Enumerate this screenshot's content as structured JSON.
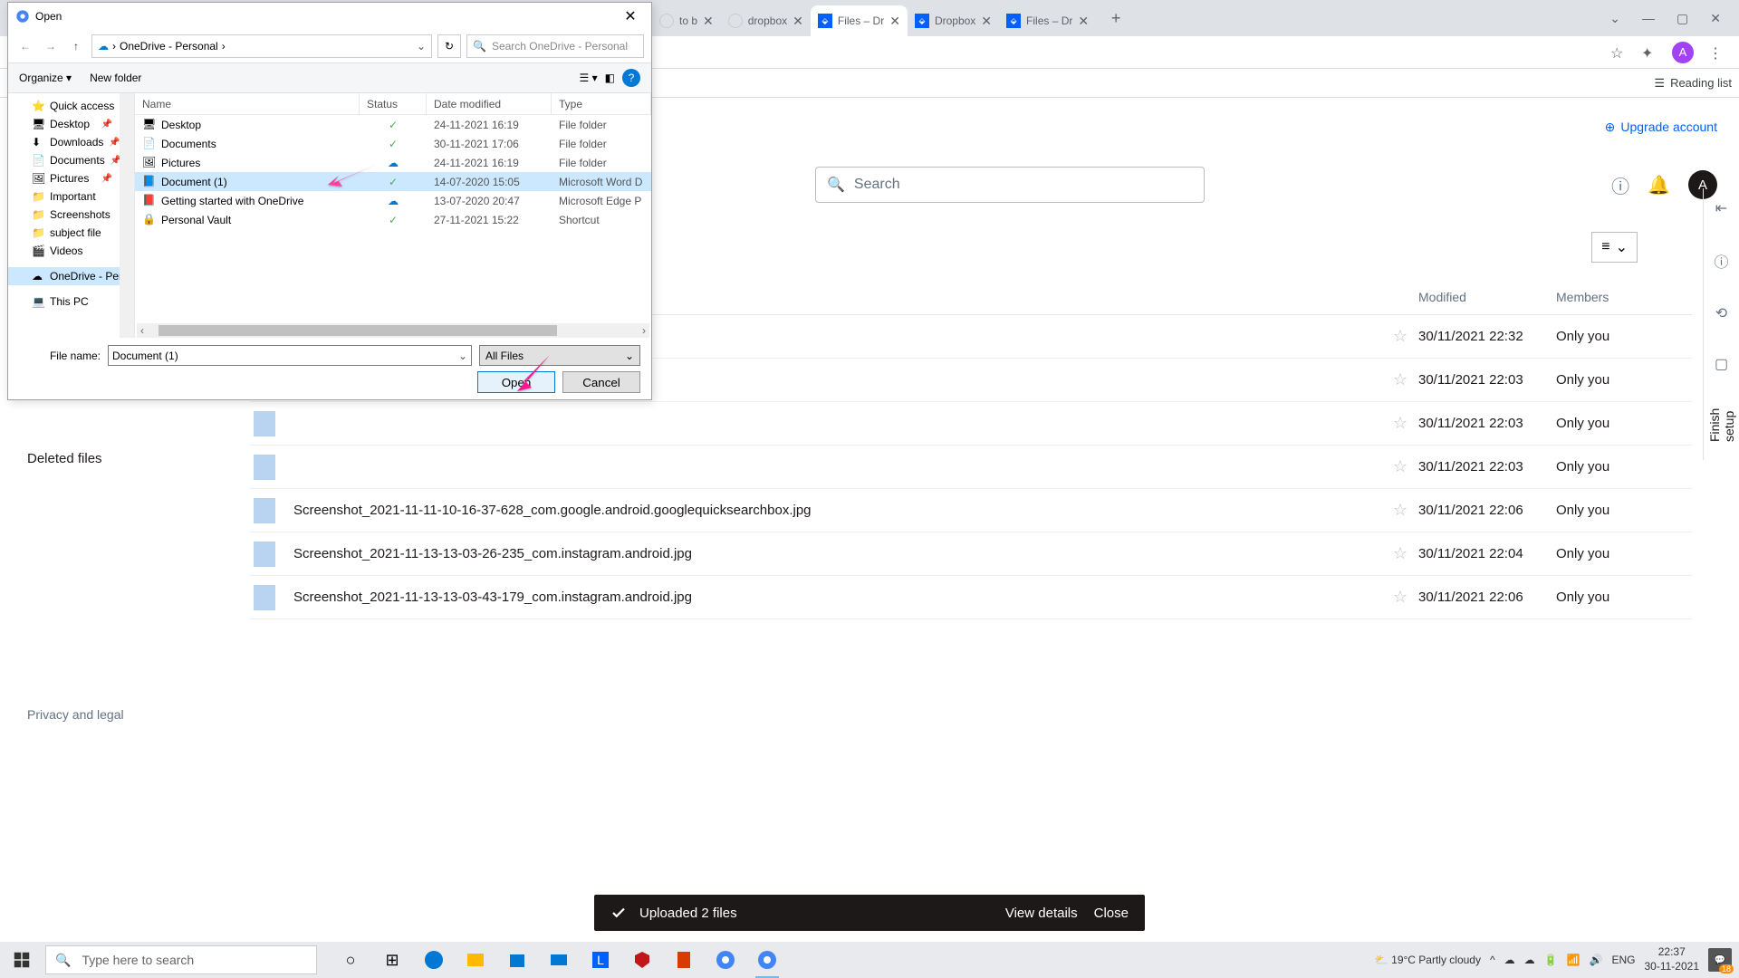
{
  "browser": {
    "tabs": [
      {
        "icon": "g",
        "label": "to b"
      },
      {
        "icon": "g",
        "label": "dropbox"
      },
      {
        "icon": "db",
        "label": "Files – Dr",
        "active": true
      },
      {
        "icon": "db",
        "label": "Dropbox"
      },
      {
        "icon": "db",
        "label": "Files – Dr"
      }
    ],
    "bookmark_label": "Reading list",
    "avatar": "A"
  },
  "dialog": {
    "title": "Open",
    "path": [
      "OneDrive - Personal"
    ],
    "search_placeholder": "Search OneDrive - Personal",
    "organize": "Organize",
    "new_folder": "New folder",
    "columns": {
      "name": "Name",
      "status": "Status",
      "date": "Date modified",
      "type": "Type"
    },
    "sidebar": [
      {
        "label": "Quick access",
        "icon": "star"
      },
      {
        "label": "Desktop",
        "icon": "desktop",
        "pinned": true
      },
      {
        "label": "Downloads",
        "icon": "download",
        "pinned": true
      },
      {
        "label": "Documents",
        "icon": "doc",
        "pinned": true
      },
      {
        "label": "Pictures",
        "icon": "pic",
        "pinned": true
      },
      {
        "label": "Important",
        "icon": "folder"
      },
      {
        "label": "Screenshots",
        "icon": "folder"
      },
      {
        "label": "subject file",
        "icon": "folder"
      },
      {
        "label": "Videos",
        "icon": "video"
      },
      {
        "label": "OneDrive - Person",
        "icon": "cloud",
        "selected": true
      },
      {
        "label": "This PC",
        "icon": "pc"
      }
    ],
    "files": [
      {
        "name": "Desktop",
        "status": "sync",
        "date": "24-11-2021 16:19",
        "type": "File folder",
        "icon": "desktop"
      },
      {
        "name": "Documents",
        "status": "sync",
        "date": "30-11-2021 17:06",
        "type": "File folder",
        "icon": "doc"
      },
      {
        "name": "Pictures",
        "status": "cloud",
        "date": "24-11-2021 16:19",
        "type": "File folder",
        "icon": "pic"
      },
      {
        "name": "Document (1)",
        "status": "sync",
        "date": "14-07-2020 15:05",
        "type": "Microsoft Word D",
        "icon": "word",
        "selected": true
      },
      {
        "name": "Getting started with OneDrive",
        "status": "cloud",
        "date": "13-07-2020 20:47",
        "type": "Microsoft Edge P",
        "icon": "pdf"
      },
      {
        "name": "Personal Vault",
        "status": "sync",
        "date": "27-11-2021 15:22",
        "type": "Shortcut",
        "icon": "vault"
      }
    ],
    "filename_label": "File name:",
    "filename_value": "Document (1)",
    "filetype": "All Files",
    "open": "Open",
    "cancel": "Cancel"
  },
  "dropbox": {
    "upgrade": "Upgrade account",
    "search_placeholder": "Search",
    "user_badge": "A",
    "left_nav": {
      "deleted": "Deleted files",
      "privacy": "Privacy and legal"
    },
    "right_tab": "Finish setup",
    "columns": {
      "modified": "Modified",
      "members": "Members"
    },
    "files": [
      {
        "name": "",
        "date": "30/11/2021 22:32",
        "members": "Only you"
      },
      {
        "name": "",
        "date": "30/11/2021 22:03",
        "members": "Only you"
      },
      {
        "name": "",
        "date": "30/11/2021 22:03",
        "members": "Only you"
      },
      {
        "name": "",
        "date": "30/11/2021 22:03",
        "members": "Only you"
      },
      {
        "name": "Screenshot_2021-11-11-10-16-37-628_com.google.android.googlequicksearchbox.jpg",
        "date": "30/11/2021 22:06",
        "members": "Only you"
      },
      {
        "name": "Screenshot_2021-11-13-13-03-26-235_com.instagram.android.jpg",
        "date": "30/11/2021 22:04",
        "members": "Only you"
      },
      {
        "name": "Screenshot_2021-11-13-13-03-43-179_com.instagram.android.jpg",
        "date": "30/11/2021 22:06",
        "members": "Only you"
      }
    ],
    "toast": {
      "message": "Uploaded 2 files",
      "view": "View details",
      "close": "Close"
    }
  },
  "taskbar": {
    "search_placeholder": "Type here to search",
    "weather": "19°C  Partly cloudy",
    "lang": "ENG",
    "time": "22:37",
    "date": "30-11-2021",
    "notif_count": "18"
  }
}
